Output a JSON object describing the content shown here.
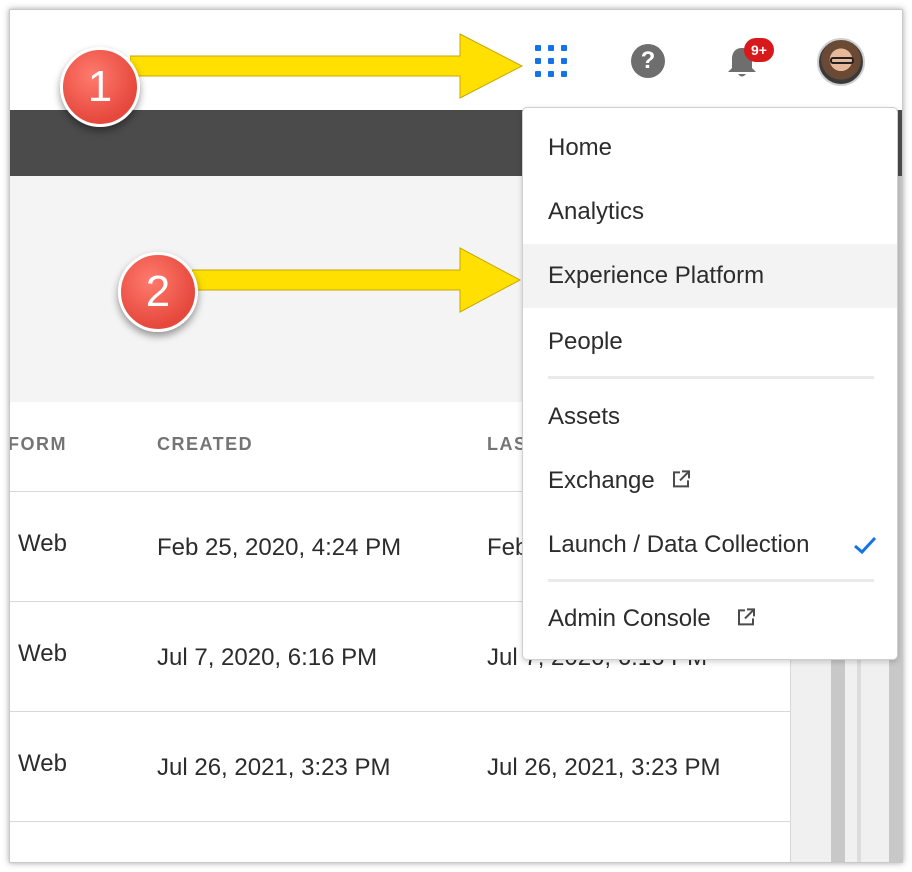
{
  "header": {
    "apps_icon": "grid-icon",
    "help_label": "?",
    "notifications_badge": "9+"
  },
  "table": {
    "columns": [
      "FORM",
      "CREATED",
      "LAS"
    ],
    "rows": [
      {
        "platform": "Web",
        "created": "Feb 25, 2020, 4:24 PM",
        "last": "Feb"
      },
      {
        "platform": "Web",
        "created": "Jul 7, 2020, 6:16 PM",
        "last": "Jul 7, 2020, 6:16 PM"
      },
      {
        "platform": "Web",
        "created": "Jul 26, 2021, 3:23 PM",
        "last": "Jul 26, 2021, 3:23 PM"
      }
    ]
  },
  "menu": {
    "items": [
      {
        "label": "Home"
      },
      {
        "label": "Analytics"
      },
      {
        "label": "Experience Platform"
      },
      {
        "label": "People"
      },
      {
        "label": "Assets"
      },
      {
        "label": "Exchange"
      },
      {
        "label": "Launch / Data Collection"
      },
      {
        "label": "Admin Console"
      }
    ]
  },
  "annotations": {
    "step1": "1",
    "step2": "2"
  },
  "colors": {
    "accent": "#1473e6",
    "badge": "#d7191c",
    "callout": "#e6483c",
    "arrow": "#ffe000"
  }
}
